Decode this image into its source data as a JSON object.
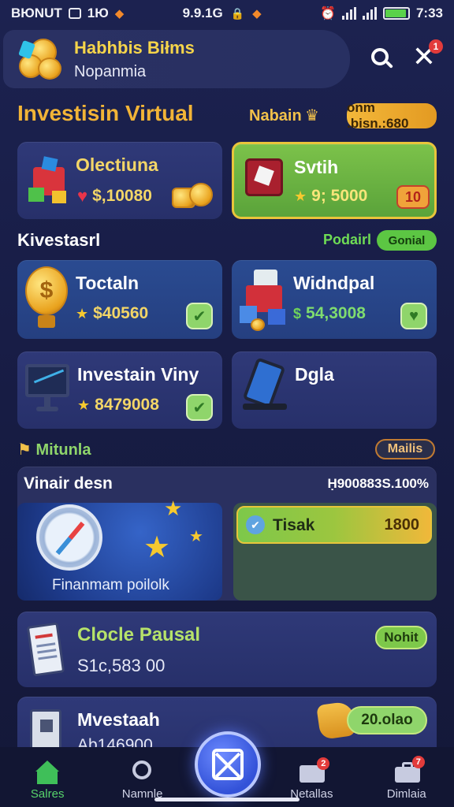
{
  "status_bar": {
    "left_text": "BЮNUT",
    "left_num": "1Ю",
    "center_text": "9.9.1G",
    "time": "7:33"
  },
  "header": {
    "title": "Habhbis Biłms",
    "subtitle": "Nopanmia",
    "notification_count": "1"
  },
  "section_virtual": {
    "title": "Investisin Virtual",
    "label": "Nabain",
    "badge": "onm .bisn.:680"
  },
  "top_cards": [
    {
      "name": "Olectiuna",
      "value": "$,10080"
    },
    {
      "name": "Svtih",
      "value": "9; 5000",
      "badge": "10"
    }
  ],
  "section_kivestasrl": {
    "title": "Kivestasrl",
    "label": "Podairl",
    "pill": "Gonial"
  },
  "grid_cards": [
    {
      "name": "Toctaln",
      "value": "$40560"
    },
    {
      "name": "Widndpal",
      "value": "54,3008"
    },
    {
      "name": "Investain Viny",
      "value": "8479008"
    },
    {
      "name": "Dgla"
    }
  ],
  "section_mitunla": {
    "title": "Mitunla",
    "pill": "Mailis"
  },
  "feature": {
    "title": "Vinair desn",
    "stat": "Ḥ900883S.100%",
    "caption": "Finanmam poilolk",
    "progress_label": "Tisak",
    "progress_value": "1800"
  },
  "list_cards": [
    {
      "title": "Clocle Pausal",
      "value": "S1c,583 00",
      "pill": "Nohit"
    },
    {
      "title": "Mvestaah",
      "value": "Ab146900",
      "pill": "20.olao"
    }
  ],
  "bottom_nav": {
    "items": [
      {
        "label": "Salres"
      },
      {
        "label": "Namnle"
      },
      {
        "label": "Netallas",
        "badge": "2"
      },
      {
        "label": "Dimlaia",
        "badge": "7"
      }
    ]
  },
  "colors": {
    "accent_gold": "#f2b437",
    "accent_green": "#57d46b",
    "background": "#171c44"
  }
}
